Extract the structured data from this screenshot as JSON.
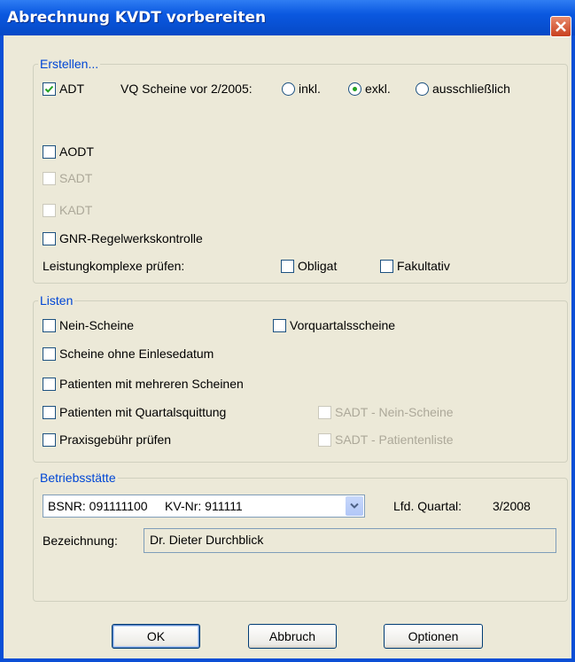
{
  "window": {
    "title": "Abrechnung KVDT vorbereiten"
  },
  "erstellen": {
    "legend": "Erstellen...",
    "adt": {
      "label": "ADT",
      "checked": true
    },
    "vq_label": "VQ Scheine vor 2/2005:",
    "vq_options": [
      {
        "label": "inkl.",
        "selected": false
      },
      {
        "label": "exkl.",
        "selected": true
      },
      {
        "label": "ausschließlich",
        "selected": false
      }
    ],
    "aodt": {
      "label": "AODT",
      "checked": false
    },
    "sadt": {
      "label": "SADT",
      "checked": false,
      "enabled": false
    },
    "kadt": {
      "label": "KADT",
      "checked": false,
      "enabled": false
    },
    "gnr": {
      "label": "GNR-Regelwerkskontrolle",
      "checked": false
    },
    "leistung_label": "Leistungkomplexe prüfen:",
    "obligat": {
      "label": "Obligat",
      "checked": false
    },
    "fakultativ": {
      "label": "Fakultativ",
      "checked": false
    }
  },
  "listen": {
    "legend": "Listen",
    "nein_scheine": "Nein-Scheine",
    "vorquartal": "Vorquartalsscheine",
    "ohne_einlese": "Scheine ohne Einlesedatum",
    "mehrere": "Patienten mit mehreren Scheinen",
    "quittung": "Patienten mit Quartalsquittung",
    "sadt_nein": "SADT - Nein-Scheine",
    "praxis": "Praxisgebühr prüfen",
    "sadt_patient": "SADT - Patientenliste"
  },
  "betrieb": {
    "legend": "Betriebsstätte",
    "combo_value": "BSNR: 091111100     KV-Nr: 911111",
    "lfd_label": "Lfd. Quartal:",
    "lfd_value": "3/2008",
    "bez_label": "Bezeichnung:",
    "bez_value": "Dr. Dieter Durchblick"
  },
  "buttons": {
    "ok": "OK",
    "cancel": "Abbruch",
    "options": "Optionen"
  },
  "colors": {
    "title_bar": "#0a58e0",
    "group_legend": "#0046d5",
    "radio_dot": "#21a121"
  }
}
